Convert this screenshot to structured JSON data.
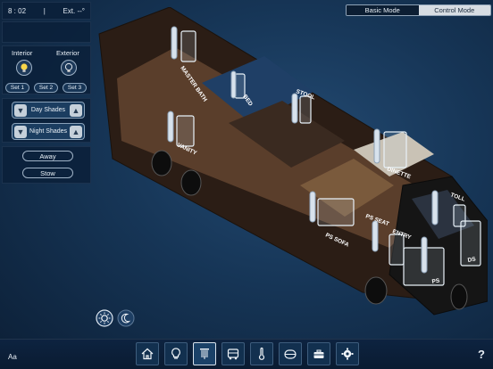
{
  "status": {
    "time": "8 : 02",
    "separator": "|",
    "exterior_temp": "Ext. --°"
  },
  "mode_switch": {
    "basic": "Basic Mode",
    "control": "Control Mode",
    "active": "control"
  },
  "lights": {
    "interior_label": "Interior",
    "exterior_label": "Exterior",
    "sets": [
      "Set 1",
      "Set 2",
      "Set 3"
    ]
  },
  "shades": {
    "day": "Day Shades",
    "night": "Night Shades"
  },
  "modes": {
    "away": "Away",
    "stow": "Stow"
  },
  "rv_labels": {
    "master_bath": "MASTER BATH",
    "bed": "BED",
    "stool": "STOOL",
    "vanity": "VANITY",
    "dinette": "DINETTE",
    "toll": "TOLL",
    "ps_seat": "PS SEAT",
    "entry": "ENTRY",
    "ps_sofa": "PS SOFA",
    "ps": "PS",
    "ds": "DS"
  },
  "footer": {
    "font_toggle": "Aa",
    "help": "?"
  },
  "nav_icons": [
    "home-icon",
    "lightbulb-icon",
    "shades-icon",
    "rv-icon",
    "thermometer-icon",
    "tank-icon",
    "toolbox-icon",
    "gear-icon"
  ],
  "colors": {
    "accent": "#d7dde3",
    "background": "#163556",
    "window_glass": "#cfe2f0"
  }
}
